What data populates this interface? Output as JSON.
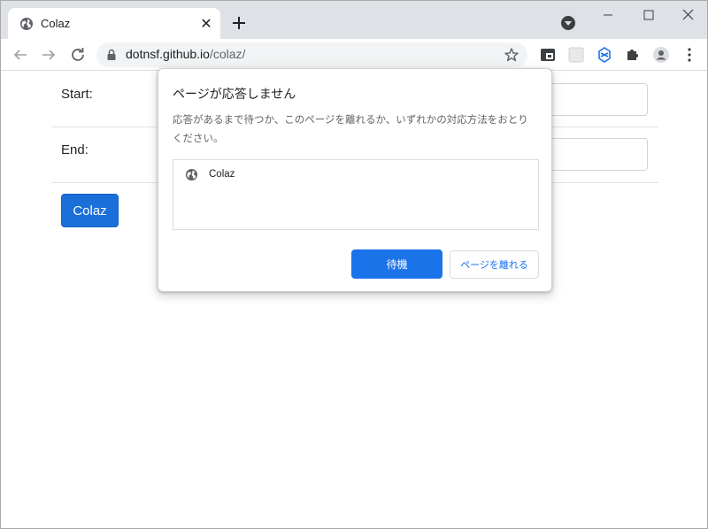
{
  "browser": {
    "tab": {
      "title": "Colaz",
      "close_glyph": "✕"
    },
    "url": {
      "host": "dotnsf.github.io",
      "path": "/colaz/"
    },
    "icons": [
      "globe-icon",
      "close-icon",
      "plus-icon",
      "tab-search-icon",
      "minimize-icon",
      "maximize-icon",
      "window-close-icon",
      "back-icon",
      "forward-icon",
      "reload-icon",
      "lock-icon",
      "star-icon",
      "extension-icon",
      "puzzle-icon",
      "profile-icon",
      "kebab-menu-icon"
    ]
  },
  "page": {
    "start_label": "Start:",
    "end_label": "End:",
    "colaz_button": "Colaz"
  },
  "dialog": {
    "title": "ページが応答しません",
    "body": "応答があるまで待つか、このページを離れるか、いずれかの対応方法をおとりください。",
    "items": [
      {
        "label": "Colaz",
        "icon": "globe-icon"
      }
    ],
    "wait_button": "待機",
    "leave_button": "ページを離れる"
  },
  "colors": {
    "accent": "#1a73e8",
    "page_button": "#1a6fd8",
    "tabstrip": "#dee1e6"
  }
}
